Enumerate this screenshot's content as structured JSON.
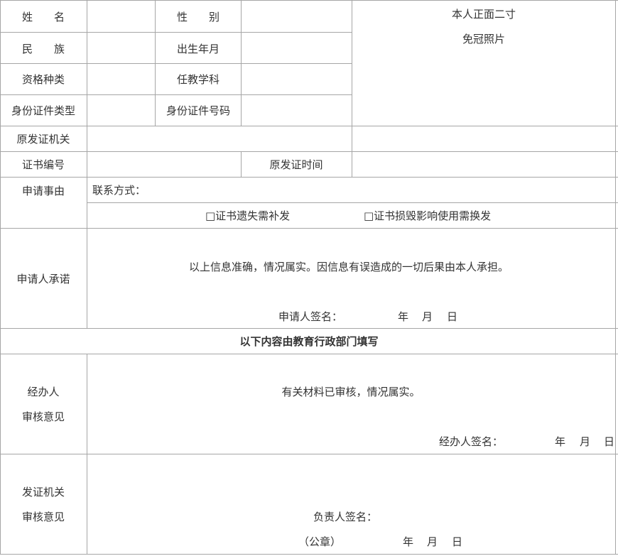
{
  "form": {
    "name_label": "姓　　名",
    "gender_label": "性　　别",
    "photo_line1": "本人正面二寸",
    "photo_line2": "免冠照片",
    "ethnicity_label": "民　　族",
    "birth_label": "出生年月",
    "qualification_label": "资格种类",
    "subject_label": "任教学科",
    "id_type_label": "身份证件类型",
    "id_number_label": "身份证件号码",
    "issuer_label": "原发证机关",
    "cert_no_label": "证书编号",
    "issue_date_label": "原发证时间",
    "reason_label": "申请事由",
    "contact_label": "联系方式：",
    "option_lost": "□证书遗失需补发",
    "option_damaged": "□证书损毁影响使用需换发",
    "promise_label": "申请人承诺",
    "promise_text": "以上信息准确，情况属实。因信息有误造成的一切后果由本人承担。",
    "applicant_sign": "申请人签名：",
    "year": "年",
    "month": "月",
    "day": "日",
    "section_title": "以下内容由教育行政部门填写",
    "handler_label_1": "经办人",
    "handler_label_2": "审核意见",
    "handler_text": "有关材料已审核，情况属实。",
    "handler_sign": "经办人签名：",
    "office_label_1": "发证机关",
    "office_label_2": "审核意见",
    "office_sign": "负责人签名：",
    "seal": "（公章）"
  }
}
